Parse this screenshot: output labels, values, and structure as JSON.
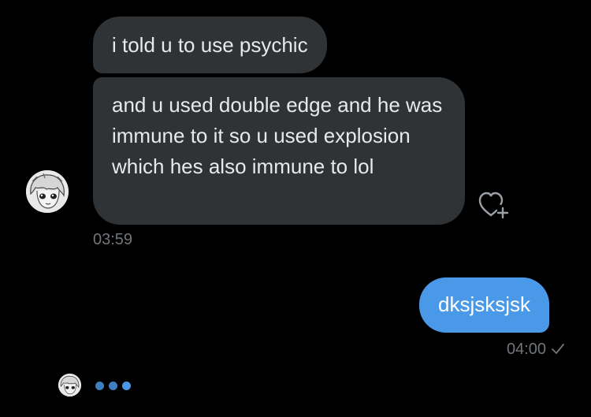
{
  "conversation": {
    "received": [
      {
        "text": "i told u to use psychic"
      },
      {
        "text": "and u used double edge and he was immune to it so u used explosion which hes also immune to lol"
      }
    ],
    "received_time": "03:59",
    "sent": [
      {
        "text": "dksjsksjsk"
      }
    ],
    "sent_time": "04:00",
    "sent_status_icon": "checkmark-icon"
  },
  "icons": {
    "like": "heart-plus-icon",
    "avatar": "anime-character-avatar",
    "typing": "typing-indicator-dots"
  },
  "colors": {
    "background": "#000000",
    "received_bubble": "#2f3336",
    "sent_bubble": "#4a99e9",
    "text": "#e7e9ea",
    "timestamp": "#71767b"
  }
}
